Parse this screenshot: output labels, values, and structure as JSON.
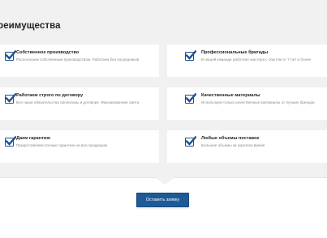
{
  "section": {
    "title": "реимущества"
  },
  "advantages": [
    {
      "title": "Собственное производство",
      "desc": "Располагаем собственным производством. Работаем без посредников"
    },
    {
      "title": "Профессиональные бригады",
      "desc": "В нашей команде работают мастера с опытом от 7 лет и более"
    },
    {
      "title": "Работаем строго по договору",
      "desc": "Все наши обязательства прописаны в договоре. Фиксированная смета"
    },
    {
      "title": "Качественные материалы",
      "desc": "Используем только качественные материалы от лучших брендов"
    },
    {
      "title": "Даем гарантию",
      "desc": "Предоставляем полную гарантию на всю продукцию"
    },
    {
      "title": "Любые объемы поставок",
      "desc": "Большие объемы за короткое время"
    }
  ],
  "cta": {
    "label": "Оставить заявку"
  },
  "icons": {
    "check": "checkbox-checked-icon"
  },
  "colors": {
    "accent": "#1e5a96",
    "panel": "#f1f1f1"
  }
}
